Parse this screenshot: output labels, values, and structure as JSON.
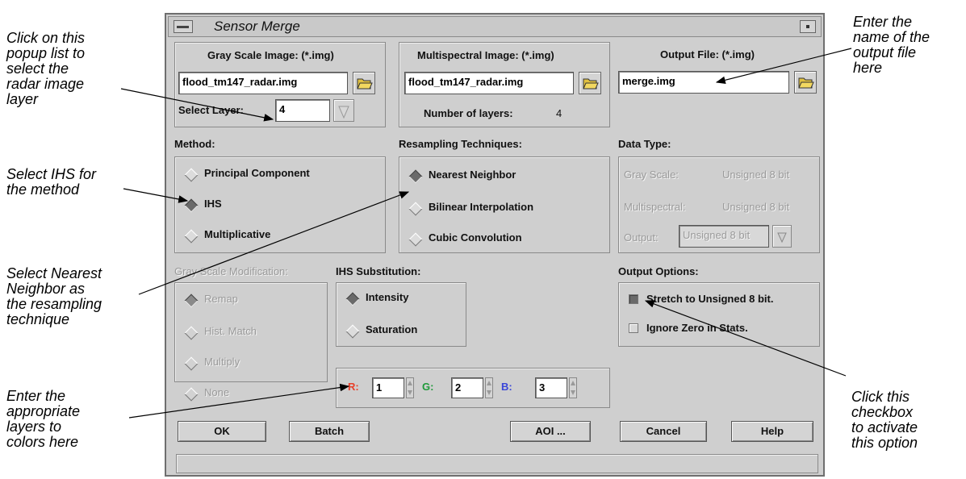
{
  "annotations": {
    "popup_list": "Click on this\npopup list to\nselect the\nradar image\nlayer",
    "ihs": "Select IHS for\nthe method",
    "nearest": "Select Nearest\nNeighbor as\nthe resampling\ntechnique",
    "layers": "Enter the\nappropriate\nlayers to\ncolors here",
    "output": "Enter the\nname of the\noutput file\nhere",
    "checkbox": "Click this\ncheckbox\nto activate\nthis option"
  },
  "window": {
    "title": "Sensor Merge"
  },
  "gray": {
    "label": "Gray Scale Image: (*.img)",
    "file": "flood_tm147_radar.img",
    "layer_label": "Select Layer:",
    "layer_value": "4"
  },
  "multi": {
    "label": "Multispectral Image: (*.img)",
    "file": "flood_tm147_radar.img",
    "layers_label": "Number of layers:",
    "layers_value": "4"
  },
  "output": {
    "label": "Output File: (*.img)",
    "file": "merge.img"
  },
  "method": {
    "label": "Method:",
    "options": [
      "Principal Component",
      "IHS",
      "Multiplicative"
    ],
    "selected": "IHS"
  },
  "resampling": {
    "label": "Resampling Techniques:",
    "options": [
      "Nearest Neighbor",
      "Bilinear Interpolation",
      "Cubic Convolution"
    ],
    "selected": "Nearest Neighbor"
  },
  "data_type": {
    "label": "Data Type:",
    "gray_label": "Gray Scale:",
    "gray_value": "Unsigned 8 bit",
    "multi_label": "Multispectral:",
    "multi_value": "Unsigned 8 bit",
    "output_label": "Output:",
    "output_value": "Unsigned 8 bit"
  },
  "gray_mod": {
    "label": "Gray Scale Modification:",
    "options": [
      "Remap",
      "Hist. Match",
      "Multiply",
      "None"
    ],
    "selected": "Remap"
  },
  "ihs_sub": {
    "label": "IHS Substitution:",
    "options": [
      "Intensity",
      "Saturation"
    ],
    "selected": "Intensity"
  },
  "rgb": {
    "r_label": "R:",
    "r_value": "1",
    "g_label": "G:",
    "g_value": "2",
    "b_label": "B:",
    "b_value": "3",
    "r_color": "#e8402a",
    "g_color": "#1e9a3a",
    "b_color": "#3a46d8"
  },
  "output_options": {
    "label": "Output Options:",
    "stretch": "Stretch to Unsigned 8 bit.",
    "stretch_checked": true,
    "ignore": "Ignore Zero in Stats.",
    "ignore_checked": false
  },
  "buttons": {
    "ok": "OK",
    "batch": "Batch",
    "aoi": "AOI ...",
    "cancel": "Cancel",
    "help": "Help"
  }
}
